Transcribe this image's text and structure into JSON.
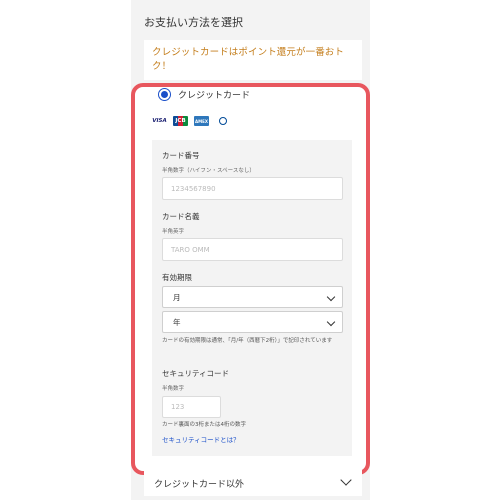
{
  "section_title": "お支払い方法を選択",
  "promo_text": "クレジットカードはポイント還元が一番おトク！",
  "credit_card": {
    "label": "クレジットカード",
    "brands": [
      "VISA",
      "JCB",
      "AMEX",
      "Diners"
    ]
  },
  "form": {
    "card_number": {
      "label": "カード番号",
      "sub": "半角数字（ハイフン・スペースなし）",
      "placeholder": "1234567890"
    },
    "card_name": {
      "label": "カード名義",
      "sub": "半角英字",
      "placeholder": "TARO OMM"
    },
    "expiry": {
      "label": "有効期限",
      "month": "月",
      "year": "年",
      "note": "カードの有効期限は通常、「月/年（西暦下2桁）」で記印されています"
    },
    "security": {
      "label": "セキュリティコード",
      "sub": "半角数字",
      "placeholder": "123",
      "note": "カード裏面の3桁または4桁の数字",
      "link": "セキュリティコードとは？"
    }
  },
  "other_method": "クレジットカード以外",
  "colors": {
    "accent_red": "#e8575e",
    "promo_text": "#c47e1c",
    "link_blue": "#1a4fc9"
  }
}
